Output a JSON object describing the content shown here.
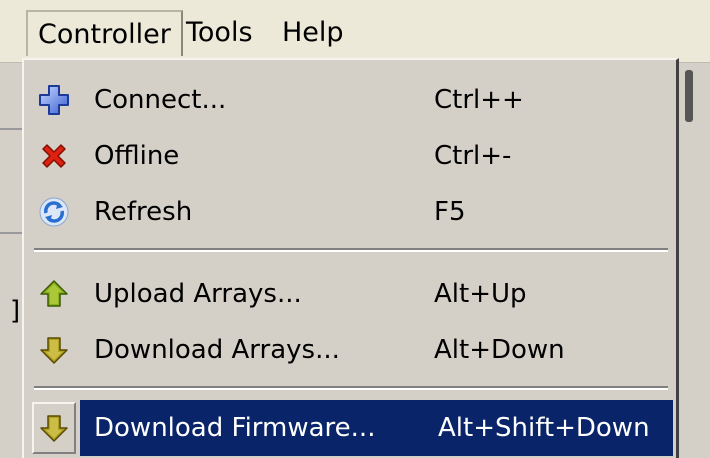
{
  "menubar": {
    "items": [
      {
        "label": "Controller"
      },
      {
        "label": "Tools"
      },
      {
        "label": "Help"
      }
    ]
  },
  "background": {
    "bracket": "]"
  },
  "menu": {
    "items": [
      {
        "label": "Connect...",
        "shortcut": "Ctrl++",
        "icon": "connect-icon"
      },
      {
        "label": "Offline",
        "shortcut": "Ctrl+-",
        "icon": "offline-icon"
      },
      {
        "label": "Refresh",
        "shortcut": "F5",
        "icon": "refresh-icon"
      },
      {
        "label": "Upload Arrays...",
        "shortcut": "Alt+Up",
        "icon": "upload-arrow-icon"
      },
      {
        "label": "Download Arrays...",
        "shortcut": "Alt+Down",
        "icon": "download-arrow-icon"
      },
      {
        "label": "Download Firmware...",
        "shortcut": "Alt+Shift+Down",
        "icon": "download-arrow-icon",
        "highlighted": true
      }
    ]
  },
  "colors": {
    "menu_bg": "#d4d0c8",
    "highlight": "#0a246a",
    "highlight_text": "#ffffff"
  }
}
